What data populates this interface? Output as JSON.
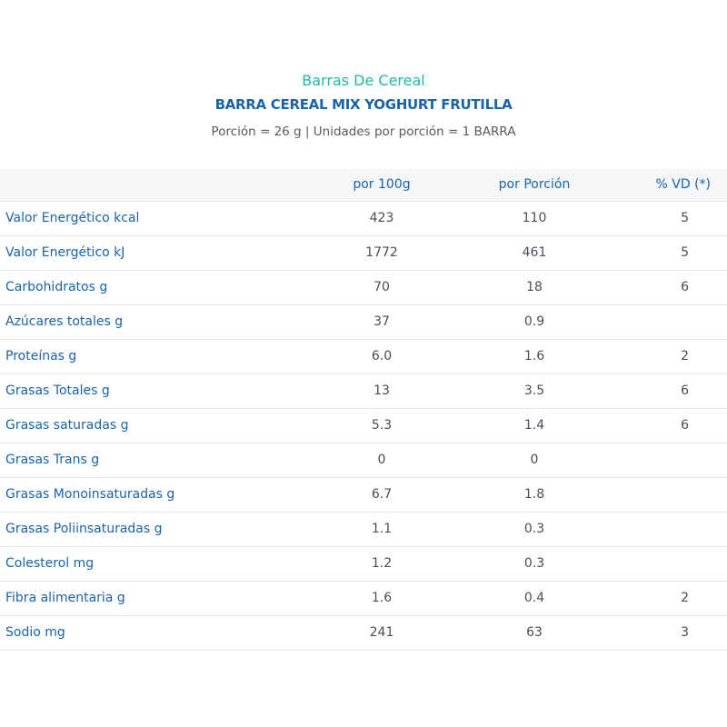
{
  "header": {
    "category": "Barras De Cereal",
    "product": "BARRA CEREAL MIX YOGHURT FRUTILLA",
    "portion": "Porción = 26 g | Unidades por porción = 1 BARRA"
  },
  "table": {
    "columns": [
      "",
      "por 100g",
      "por Porción",
      "% VD (*)"
    ],
    "rows": [
      {
        "name": "Valor Energético kcal",
        "per100": "423",
        "perPortion": "110",
        "vd": "5"
      },
      {
        "name": "Valor Energético kJ",
        "per100": "1772",
        "perPortion": "461",
        "vd": "5"
      },
      {
        "name": "Carbohidratos g",
        "per100": "70",
        "perPortion": "18",
        "vd": "6"
      },
      {
        "name": "Azúcares totales g",
        "per100": "37",
        "perPortion": "0.9",
        "vd": ""
      },
      {
        "name": "Proteínas g",
        "per100": "6.0",
        "perPortion": "1.6",
        "vd": "2"
      },
      {
        "name": "Grasas Totales g",
        "per100": "13",
        "perPortion": "3.5",
        "vd": "6"
      },
      {
        "name": "Grasas saturadas g",
        "per100": "5.3",
        "perPortion": "1.4",
        "vd": "6"
      },
      {
        "name": "Grasas Trans g",
        "per100": "0",
        "perPortion": "0",
        "vd": ""
      },
      {
        "name": "Grasas Monoinsaturadas g",
        "per100": "6.7",
        "perPortion": "1.8",
        "vd": ""
      },
      {
        "name": "Grasas Poliinsaturadas g",
        "per100": "1.1",
        "perPortion": "0.3",
        "vd": ""
      },
      {
        "name": "Colesterol mg",
        "per100": "1.2",
        "perPortion": "0.3",
        "vd": ""
      },
      {
        "name": "Fibra alimentaria g",
        "per100": "1.6",
        "perPortion": "0.4",
        "vd": "2"
      },
      {
        "name": "Sodio mg",
        "per100": "241",
        "perPortion": "63",
        "vd": "3"
      }
    ]
  },
  "colors": {
    "category": "#1fb8a6",
    "product": "#1a64a8",
    "label": "#1a64a8",
    "value": "#4a4f54",
    "header_bg": "#f4f6f8",
    "divider": "#e3e6e9"
  }
}
